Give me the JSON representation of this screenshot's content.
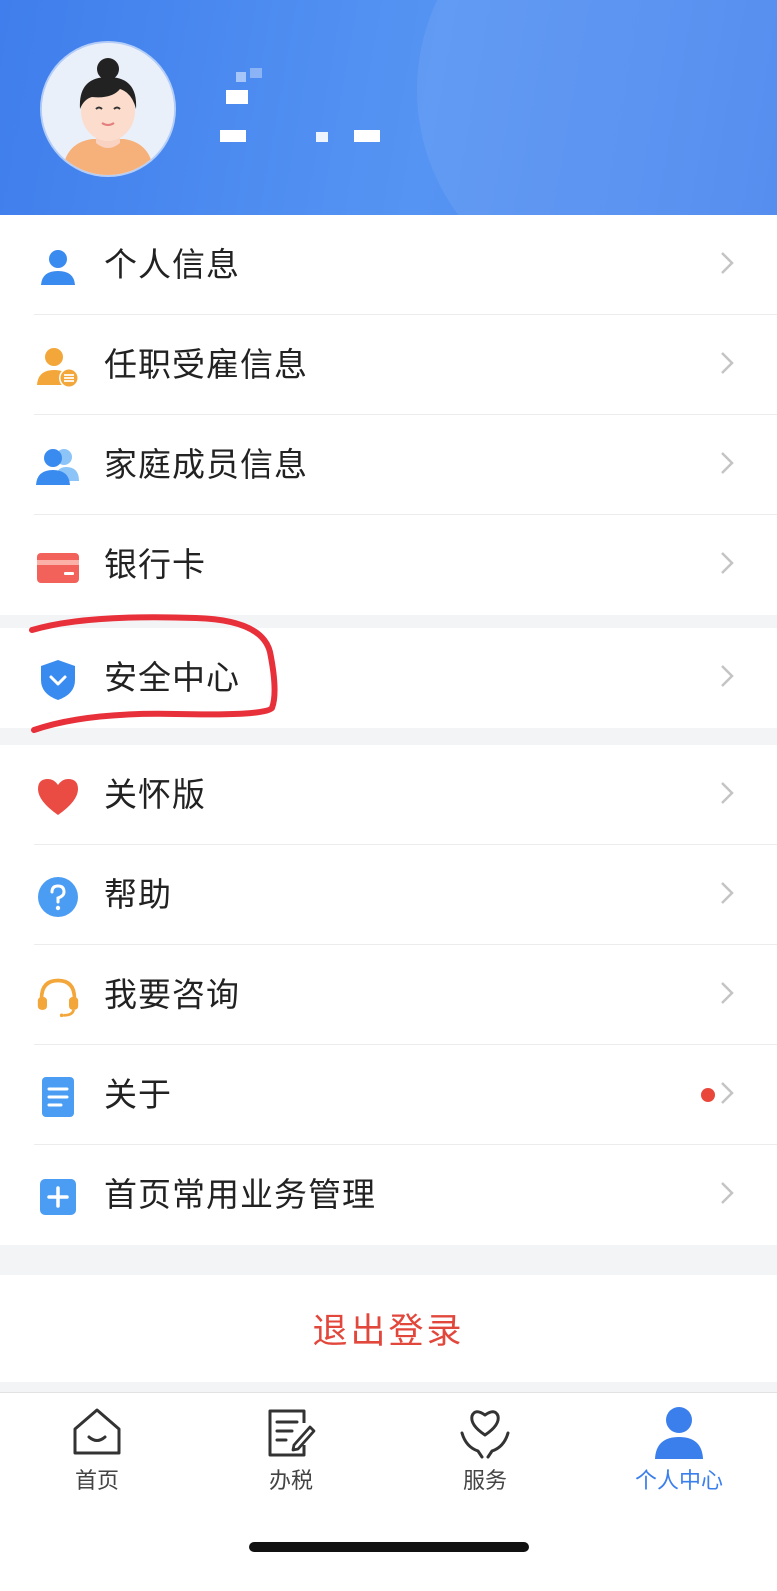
{
  "menu_group_1": [
    {
      "label": "个人信息",
      "icon": "person-icon"
    },
    {
      "label": "任职受雇信息",
      "icon": "employment-icon"
    },
    {
      "label": "家庭成员信息",
      "icon": "family-icon"
    },
    {
      "label": "银行卡",
      "icon": "bank-card-icon"
    }
  ],
  "menu_group_2": [
    {
      "label": "安全中心",
      "icon": "shield-icon"
    }
  ],
  "menu_group_3": [
    {
      "label": "关怀版",
      "icon": "heart-icon"
    },
    {
      "label": "帮助",
      "icon": "help-icon"
    },
    {
      "label": "我要咨询",
      "icon": "headset-icon"
    },
    {
      "label": "关于",
      "icon": "document-icon",
      "badge": "red-dot"
    },
    {
      "label": "首页常用业务管理",
      "icon": "plus-icon"
    }
  ],
  "logout_label": "退出登录",
  "tabs": [
    {
      "label": "首页",
      "icon": "home-icon",
      "active": false
    },
    {
      "label": "办税",
      "icon": "edit-form-icon",
      "active": false
    },
    {
      "label": "服务",
      "icon": "heart-hands-icon",
      "active": false
    },
    {
      "label": "个人中心",
      "icon": "person-icon",
      "active": true
    }
  ],
  "colors": {
    "header_blue": "#4a86ee",
    "accent_blue": "#3a7fec",
    "logout_red": "#e2473c",
    "annotation_red": "#e8303a"
  }
}
